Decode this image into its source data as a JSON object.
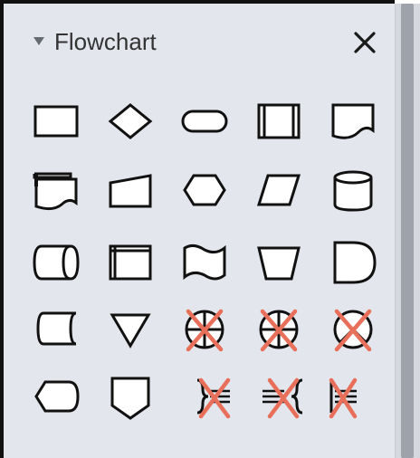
{
  "panel": {
    "title": "Flowchart",
    "collapse_icon": "triangle-down-icon",
    "close_icon": "close-x-icon"
  },
  "colors": {
    "panel_bg": "#e3e6ec",
    "shape_stroke": "#111111",
    "shape_fill": "#ffffff",
    "cross_mark": "#e8705a",
    "title_text": "#333333"
  },
  "shapes": [
    "process",
    "decision",
    "terminator",
    "predefined-process",
    "document",
    "multi-document",
    "manual-input",
    "preparation",
    "data",
    "database",
    "direct-access-storage",
    "internal-storage",
    "paper-tape",
    "manual-operation",
    "delay",
    "stored-data",
    "merge",
    "or",
    "summing-junction",
    "collate",
    "display",
    "off-page-reference",
    "annotation-left",
    "annotation-both",
    "annotation-right"
  ]
}
